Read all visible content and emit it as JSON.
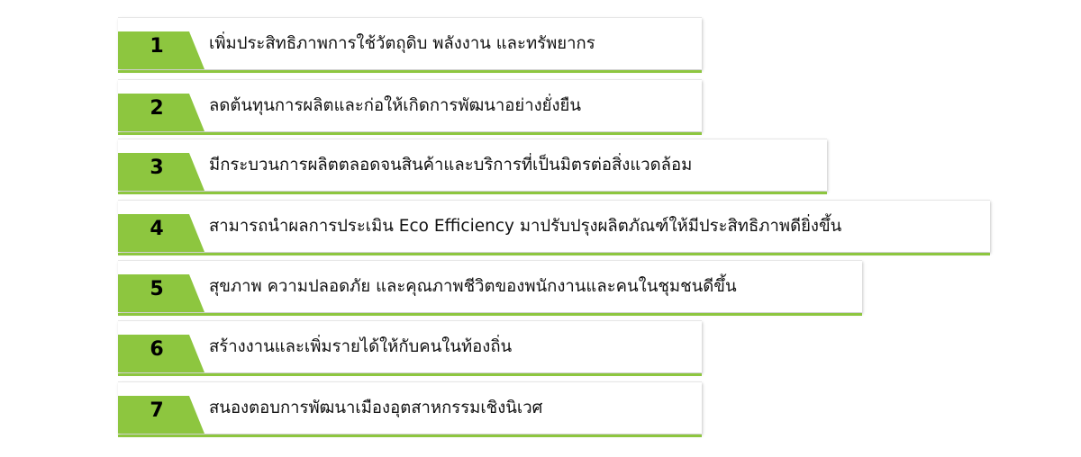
{
  "accent_color": "#8dc63f",
  "items": [
    {
      "number": "1",
      "text": "เพิ่มประสิทธิภาพการใช้วัตถุดิบ พลังงาน และทรัพยากร"
    },
    {
      "number": "2",
      "text": "ลดต้นทุนการผลิตและก่อให้เกิดการพัฒนาอย่างยั่งยืน"
    },
    {
      "number": "3",
      "text": "มีกระบวนการผลิตตลอดจนสินค้าและบริการที่เป็นมิตรต่อสิ่งแวดล้อม"
    },
    {
      "number": "4",
      "text": "สามารถนำผลการประเมิน Eco Efficiency มาปรับปรุงผลิตภัณฑ์ให้มีประสิทธิภาพดียิ่งขึ้น"
    },
    {
      "number": "5",
      "text": "สุขภาพ ความปลอดภัย และคุณภาพชีวิตของพนักงานและคนในชุมชนดีขึ้น"
    },
    {
      "number": "6",
      "text": "สร้างงานและเพิ่มรายได้ให้กับคนในท้องถิ่น"
    },
    {
      "number": "7",
      "text": "สนองตอบการพัฒนาเมืองอุตสาหกรรมเชิงนิเวศ"
    }
  ]
}
